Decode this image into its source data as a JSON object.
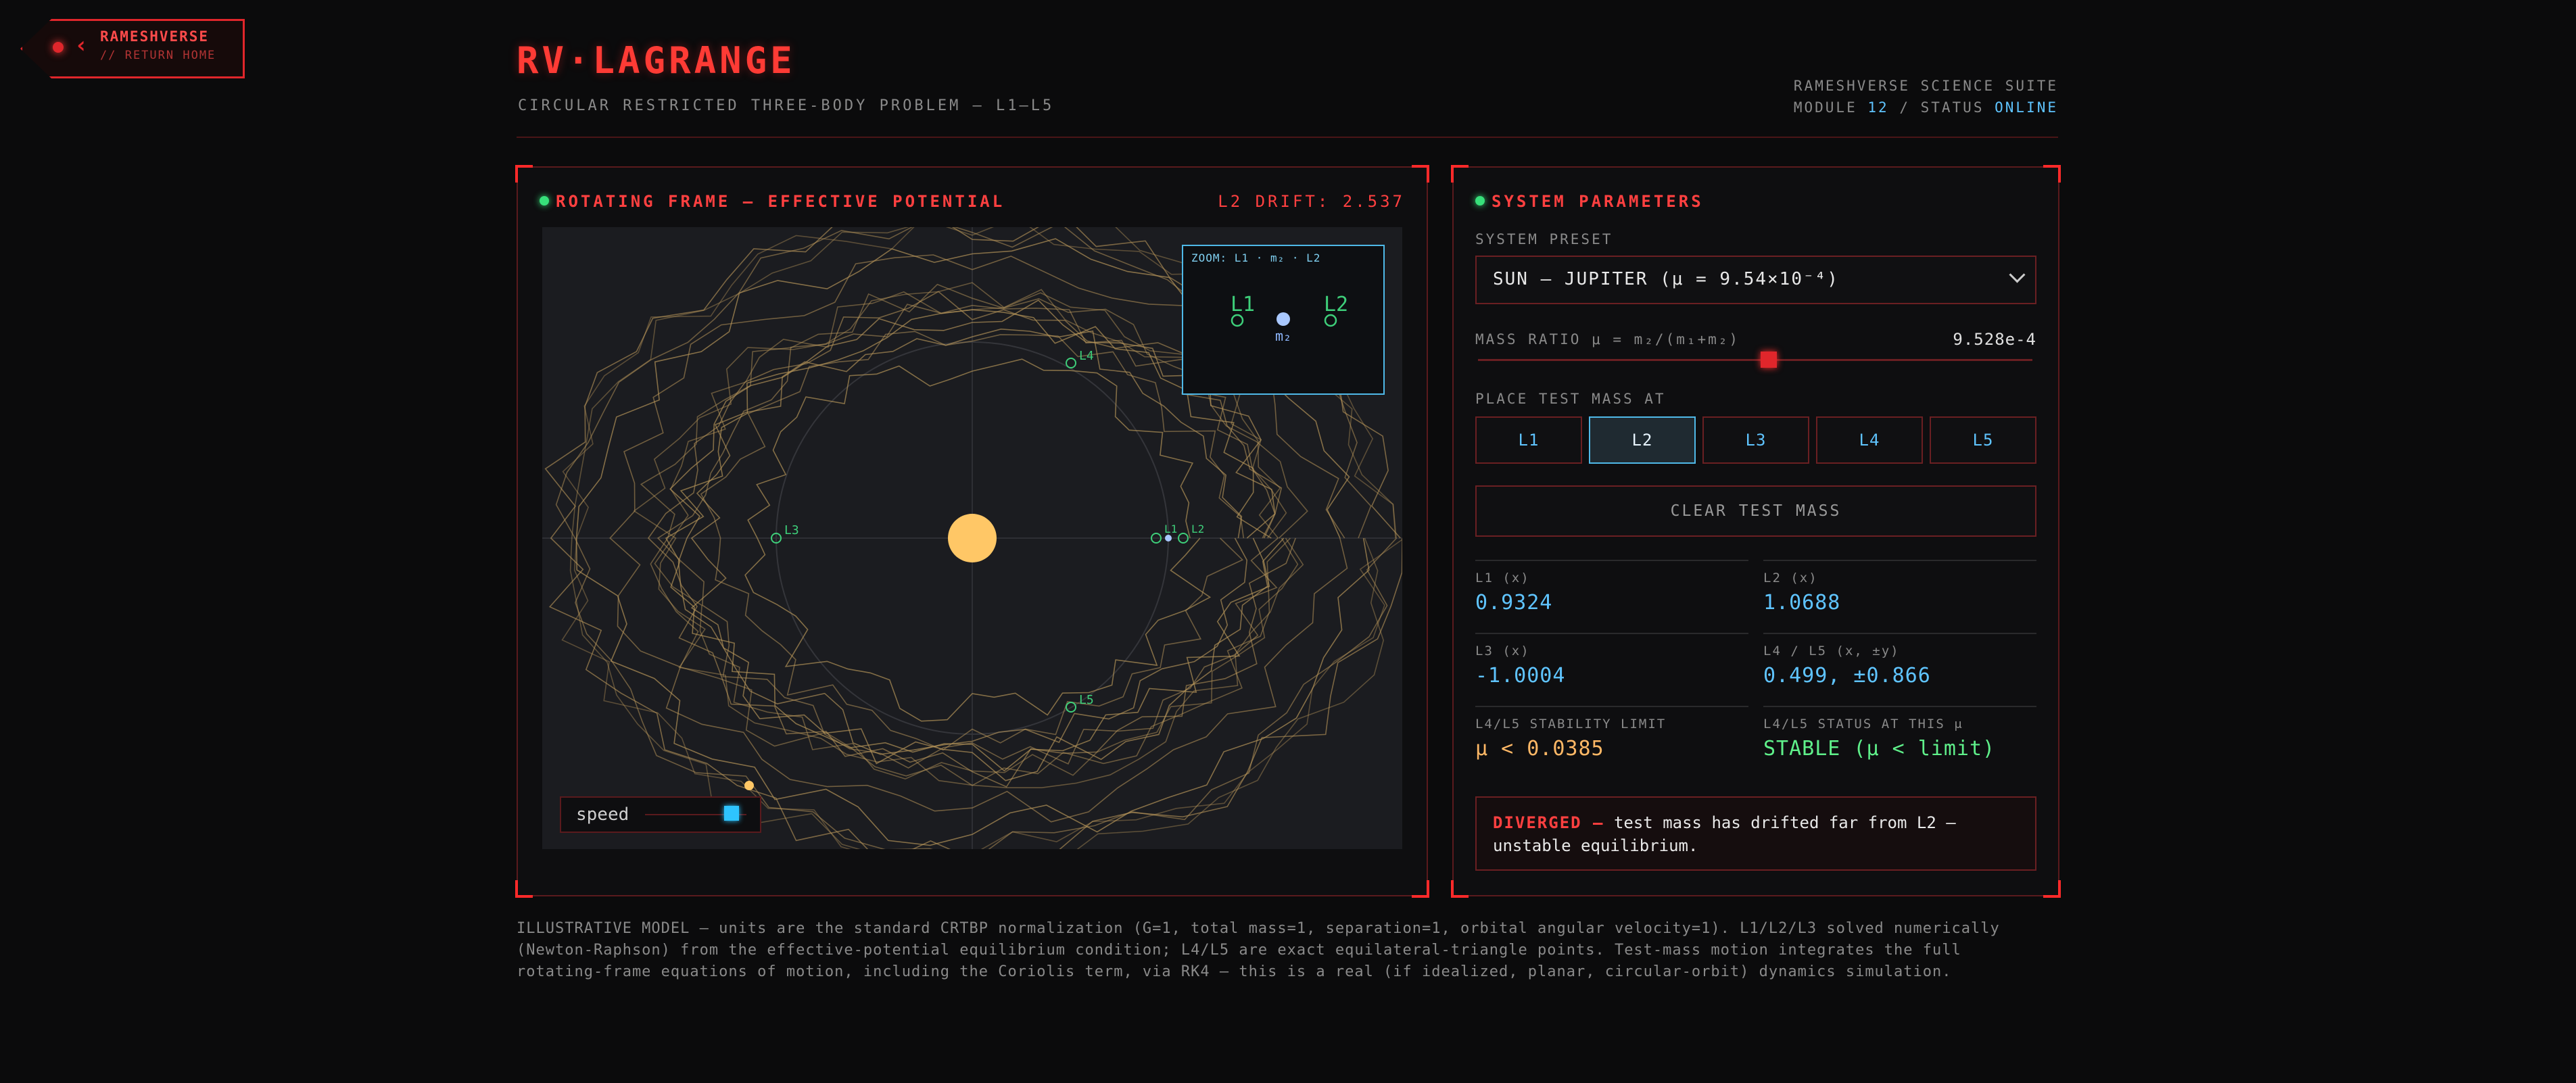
{
  "back": {
    "title": "RAMESHVERSE",
    "subtitle": "// RETURN HOME"
  },
  "header": {
    "title": "RV·LAGRANGE",
    "subtitle": "CIRCULAR RESTRICTED THREE-BODY PROBLEM — L1–L5",
    "suite": "RAMESHVERSE SCIENCE SUITE",
    "module_label": "MODULE",
    "module_num": "12",
    "status_label": "/ STATUS",
    "status": "ONLINE"
  },
  "viz": {
    "heading": "ROTATING FRAME — EFFECTIVE POTENTIAL",
    "drift": "L2 DRIFT: 2.537",
    "labels": {
      "l1": "L1",
      "l2": "L2",
      "l3": "L3",
      "l4": "L4",
      "l5": "L5"
    },
    "zoom": {
      "title": "ZOOM: L1 · m₂ · L2",
      "l1": "L1",
      "l2": "L2",
      "m2": "m₂"
    },
    "speed_label": "speed",
    "speed_level": 0.85
  },
  "params": {
    "heading": "SYSTEM PARAMETERS",
    "preset_label": "SYSTEM PRESET",
    "preset_value": "SUN – JUPITER (μ = 9.54×10⁻⁴)",
    "mass_label": "MASS RATIO μ = m₂/(m₁+m₂)",
    "mass_value": "9.528e-4",
    "place_label": "PLACE TEST MASS AT",
    "buttons": [
      "L1",
      "L2",
      "L3",
      "L4",
      "L5"
    ],
    "active_button": "L2",
    "clear_label": "CLEAR TEST MASS",
    "readouts": [
      {
        "label": "L1 (x)",
        "value": "0.9324"
      },
      {
        "label": "L2 (x)",
        "value": "1.0688"
      },
      {
        "label": "L3 (x)",
        "value": "-1.0004"
      },
      {
        "label": "L4 / L5 (x, ±y)",
        "value": "0.499, ±0.866"
      },
      {
        "label": "L4/L5 STABILITY LIMIT",
        "value": "μ < 0.0385"
      },
      {
        "label": "L4/L5 STATUS AT THIS μ",
        "value": "STABLE (μ < limit)"
      }
    ],
    "alert_title": "DIVERGED —",
    "alert_text": "test mass has drifted far from L2 — unstable equilibrium."
  },
  "footer": "ILLUSTRATIVE MODEL — units are the standard CRTBP normalization (G=1, total mass=1, separation=1, orbital angular velocity=1). L1/L2/L3 solved numerically (Newton-Raphson) from the effective-potential equilibrium condition; L4/L5 are exact equilateral-triangle points. Test-mass motion integrates the full rotating-frame equations of motion, including the Coriolis term, via RK4 — this is a real (if idealized, planar, circular-orbit) dynamics simulation.",
  "colors": {
    "accent_red": "#ff3b35",
    "accent_blue": "#5fc4ff",
    "accent_green": "#37e07a",
    "sun": "#ffc766",
    "trail": "#b8965a"
  }
}
